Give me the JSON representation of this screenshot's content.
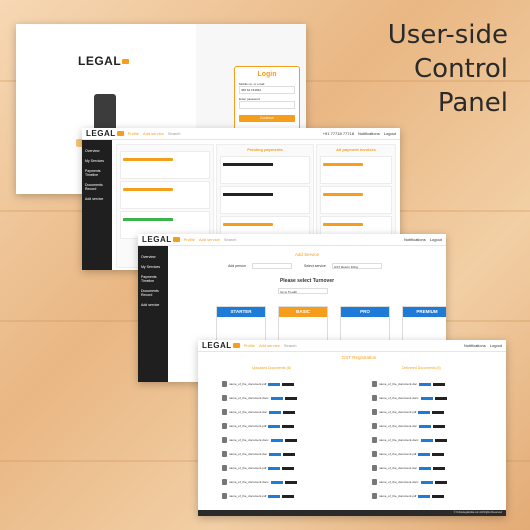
{
  "headline": {
    "line1": "User-side",
    "line2": "Control",
    "line3": "Panel"
  },
  "brand": {
    "logo_text": "LEGAL"
  },
  "login": {
    "title": "Login",
    "username_label": "Mobile no. or email",
    "username_value": "456 64 154662",
    "password_label": "Enter password",
    "button": "Continue"
  },
  "nav": {
    "profile": "Profile",
    "add_service": "Add service",
    "search_placeholder": "Search",
    "notifications": "Notifications",
    "logout": "Logout",
    "phone": "+91 77718 77718"
  },
  "sidebar": {
    "items": [
      "Overview",
      "My Services",
      "Payments Timeline",
      "Documents Record",
      "Add service"
    ],
    "help": "Help"
  },
  "payments": {
    "col1": "",
    "col2": "Pending payments",
    "col3": "All payment invoices",
    "filter": "Filter by"
  },
  "add_service": {
    "title": "Add Service",
    "add_person_label": "Add person",
    "select_service_label": "Select service",
    "select_service_value": "GST Return Filing",
    "prompt": "Please select Turnover",
    "turnover_value": "Up to 5 Lakh",
    "plans": [
      "STARTER",
      "BASIC",
      "PRO",
      "PREMIUM"
    ]
  },
  "files": {
    "title": "GST Registration",
    "uploaded": "Uploaded Documents (6)",
    "delivered": "Delivered Documents (6)",
    "file_pdf": "name_of_the_document.pdf",
    "file_doc": "name_of_the_document.doc",
    "file_docx": "name_of_the_document.docx",
    "footer": "© Onlinelegalindia.com All Rights Reserved"
  },
  "colors": {
    "accent": "#f59e1b",
    "dark": "#1f1f1f",
    "blue": "#1e7bd8"
  }
}
